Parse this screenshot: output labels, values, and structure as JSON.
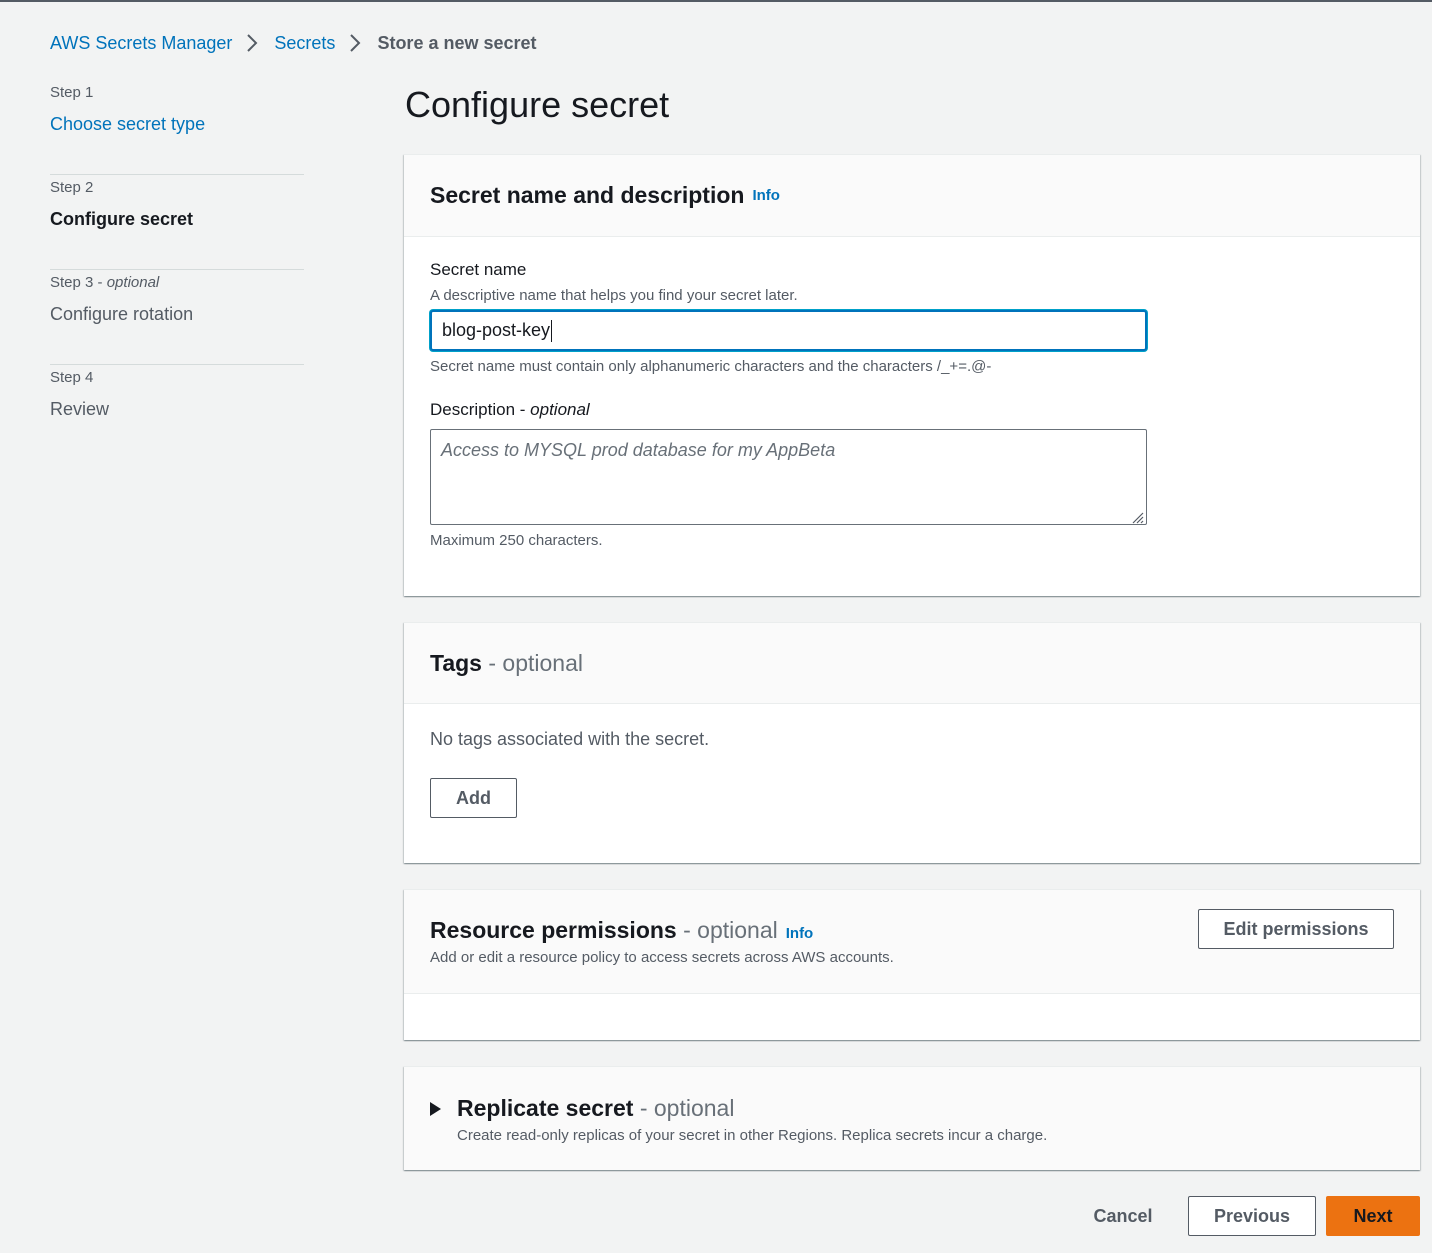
{
  "breadcrumb": {
    "items": [
      "AWS Secrets Manager",
      "Secrets"
    ],
    "current": "Store a new secret"
  },
  "steps": [
    {
      "num": "Step 1",
      "title": "Choose secret type"
    },
    {
      "num": "Step 2",
      "title": "Configure secret"
    },
    {
      "num": "Step 3",
      "num_optional": "optional",
      "title": "Configure rotation"
    },
    {
      "num": "Step 4",
      "title": "Review"
    }
  ],
  "page": {
    "title": "Configure secret"
  },
  "name_section": {
    "title": "Secret name and description",
    "info": "Info",
    "name_label": "Secret name",
    "name_desc": "A descriptive name that helps you find your secret later.",
    "name_value": "blog-post-key",
    "name_constraint": "Secret name must contain only alphanumeric characters and the characters /_+=.@-",
    "desc_label": "Description",
    "desc_optional": "optional",
    "desc_placeholder": "Access to MYSQL prod database for my AppBeta",
    "desc_constraint": "Maximum 250 characters."
  },
  "tags_section": {
    "title": "Tags",
    "optional": "- optional",
    "empty": "No tags associated with the secret.",
    "add_label": "Add"
  },
  "permissions_section": {
    "title": "Resource permissions",
    "optional": "- optional",
    "info": "Info",
    "desc": "Add or edit a resource policy to access secrets across AWS accounts.",
    "edit_label": "Edit permissions"
  },
  "replicate_section": {
    "title": "Replicate secret",
    "optional": "- optional",
    "desc": "Create read-only replicas of your secret in other Regions. Replica secrets incur a charge."
  },
  "footer": {
    "cancel": "Cancel",
    "previous": "Previous",
    "next": "Next"
  },
  "colors": {
    "link": "#0073bb",
    "primary": "#ec7211",
    "background": "#f2f3f3"
  }
}
